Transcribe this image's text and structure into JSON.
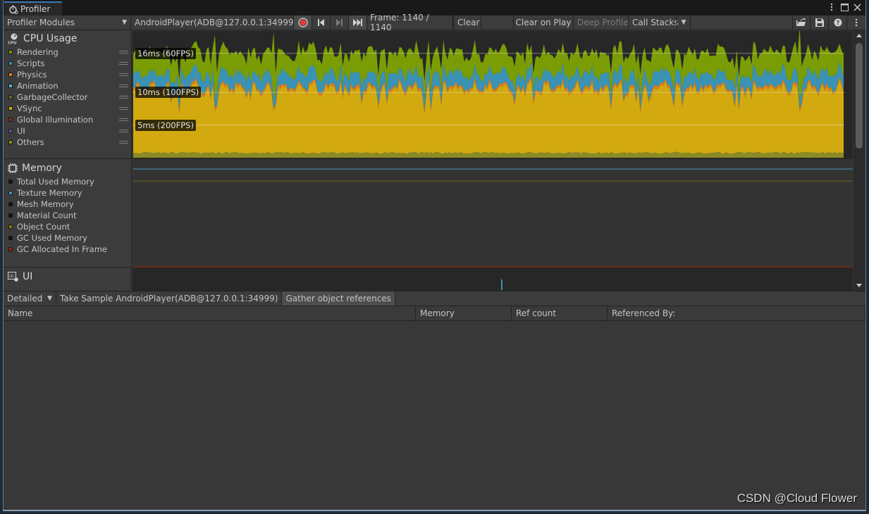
{
  "window": {
    "tab_title": "Profiler",
    "menu_icon": "kebab-icon",
    "maximize_icon": "maximize-icon",
    "close_icon": "close-icon"
  },
  "toolbar": {
    "modules_dropdown": "Profiler Modules",
    "target_dropdown": "AndroidPlayer(ADB@127.0.0.1:34999)",
    "record_icon": "record-icon",
    "prev_frame_icon": "step-back-icon",
    "next_frame_icon": "step-forward-icon",
    "current_frame_icon": "skip-to-end-icon",
    "frame_label": "Frame: 1140 / 1140",
    "clear": "Clear",
    "clear_on_play": "Clear on Play",
    "deep_profile": "Deep Profile",
    "call_stacks": "Call Stacks",
    "load_icon": "open-folder-icon",
    "save_icon": "save-icon",
    "help_icon": "help-icon",
    "more_icon": "kebab-icon"
  },
  "cpu_module": {
    "title": "CPU Usage",
    "legend": [
      {
        "label": "Rendering",
        "color": "#7a9d06"
      },
      {
        "label": "Scripts",
        "color": "#3a93b5"
      },
      {
        "label": "Physics",
        "color": "#e07f18"
      },
      {
        "label": "Animation",
        "color": "#4fb9c4"
      },
      {
        "label": "GarbageCollector",
        "color": "#6e6b16"
      },
      {
        "label": "VSync",
        "color": "#d2aa10"
      },
      {
        "label": "Global Illumination",
        "color": "#8b2b10"
      },
      {
        "label": "UI",
        "color": "#6c4a9c"
      },
      {
        "label": "Others",
        "color": "#8a8a26"
      }
    ],
    "markers": [
      {
        "label": "16ms (60FPS)",
        "ms": 16
      },
      {
        "label": "10ms (100FPS)",
        "ms": 10
      },
      {
        "label": "5ms (200FPS)",
        "ms": 5
      }
    ]
  },
  "memory_module": {
    "title": "Memory",
    "legend": [
      {
        "label": "Total Used Memory",
        "color": "#111111"
      },
      {
        "label": "Texture Memory",
        "color": "#3a93b5"
      },
      {
        "label": "Mesh Memory",
        "color": "#111111"
      },
      {
        "label": "Material Count",
        "color": "#111111"
      },
      {
        "label": "Object Count",
        "color": "#857a10"
      },
      {
        "label": "GC Used Memory",
        "color": "#111111"
      },
      {
        "label": "GC Allocated In Frame",
        "color": "#8b2b10"
      }
    ]
  },
  "ui_module": {
    "title": "UI"
  },
  "bottom": {
    "view_dropdown": "Detailed",
    "take_sample": "Take Sample AndroidPlayer(ADB@127.0.0.1:34999)",
    "gather_refs": "Gather object references",
    "columns": [
      "Name",
      "Memory",
      "Ref count",
      "Referenced By:"
    ]
  },
  "chart_data": {
    "type": "area",
    "title": "CPU Usage",
    "xlabel": "Frame",
    "ylabel": "ms",
    "x_range": [
      1,
      1140
    ],
    "ylim": [
      0,
      19
    ],
    "stack_order": [
      "Others",
      "VSync",
      "Physics",
      "Scripts",
      "Rendering"
    ],
    "typical_ms": {
      "Others": 0.6,
      "VSync": 9.8,
      "Physics": 0.3,
      "Scripts": 1.8,
      "Rendering": 3.2
    },
    "total_typical_ms": 15.7,
    "spikes_frame_ms": [
      [
        130,
        18.5
      ],
      [
        225,
        19.0
      ],
      [
        1070,
        20.0
      ]
    ]
  },
  "watermark": "CSDN @Cloud Flower"
}
